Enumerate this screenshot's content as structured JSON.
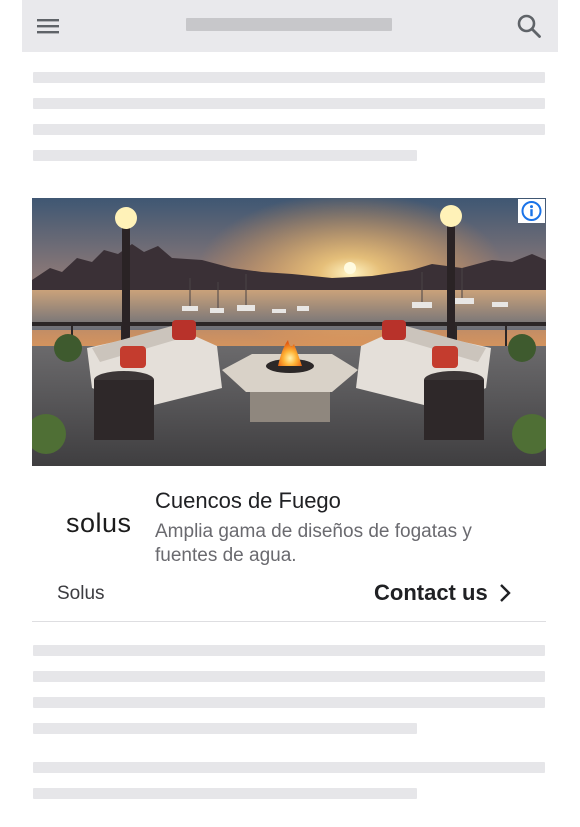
{
  "ad": {
    "brand_logo": "solus",
    "headline": "Cuencos de Fuego",
    "description": "Amplia gama de diseños de fogatas y fuentes de agua.",
    "advertiser": "Solus",
    "cta_label": "Contact us"
  },
  "icons": {
    "menu": "hamburger-menu-icon",
    "search": "magnifier-search-icon",
    "info": "info-circle-icon",
    "cta": "chevron-right-icon"
  },
  "colors": {
    "topbar_bg": "#e9e9ec",
    "skeleton": "#e6e6e9",
    "info_blue": "#1a73e8",
    "text_dark": "#202124"
  }
}
